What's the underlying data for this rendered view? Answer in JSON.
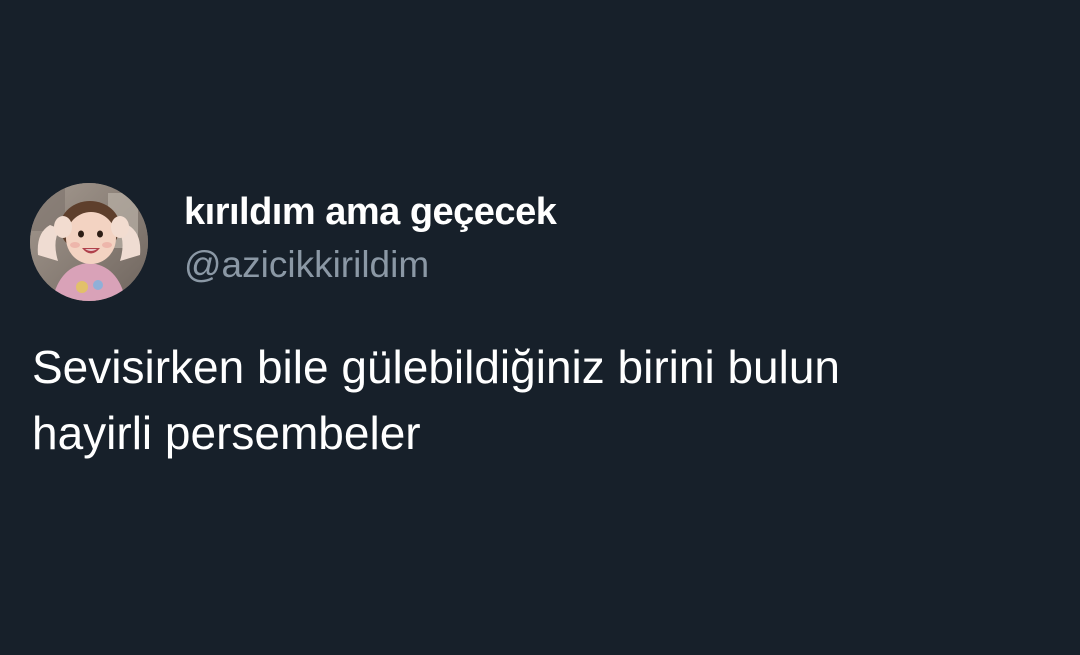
{
  "tweet": {
    "display_name": "kırıldım ama geçecek",
    "handle": "@azicikkirildim",
    "text_lines": [
      "Sevisirken bile gülebildiğiniz birini bulun",
      "hayirli persembeler"
    ]
  },
  "colors": {
    "background": "#17202a",
    "name": "#ffffff",
    "handle": "#8b98a5",
    "text": "#ffffff"
  }
}
